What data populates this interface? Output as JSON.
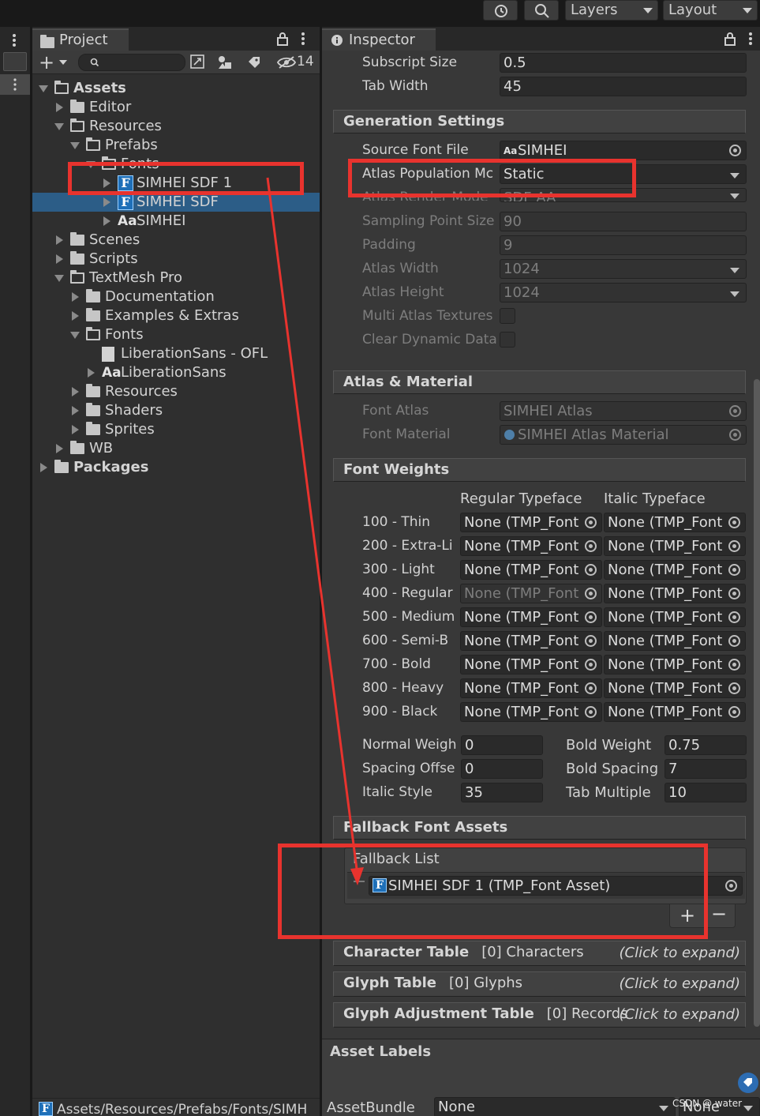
{
  "topbar": {
    "layers_label": "Layers",
    "layout_label": "Layout"
  },
  "project": {
    "tab_label": "Project",
    "hidden_count": "14",
    "tree": [
      {
        "label": "Assets",
        "indent": 0,
        "expanded": true,
        "kind": "folder",
        "bold": true
      },
      {
        "label": "Editor",
        "indent": 1,
        "expanded": false,
        "kind": "folder"
      },
      {
        "label": "Resources",
        "indent": 1,
        "expanded": true,
        "kind": "folder"
      },
      {
        "label": "Prefabs",
        "indent": 2,
        "expanded": true,
        "kind": "folder"
      },
      {
        "label": "Fonts",
        "indent": 3,
        "expanded": true,
        "kind": "folder"
      },
      {
        "label": "SIMHEI SDF 1",
        "indent": 4,
        "expanded": false,
        "kind": "fontasset"
      },
      {
        "label": "SIMHEI SDF",
        "indent": 4,
        "expanded": false,
        "kind": "fontasset",
        "selected": true
      },
      {
        "label": "SIMHEI",
        "indent": 4,
        "expanded": false,
        "kind": "font"
      },
      {
        "label": "Scenes",
        "indent": 1,
        "expanded": false,
        "kind": "folder"
      },
      {
        "label": "Scripts",
        "indent": 1,
        "expanded": false,
        "kind": "folder"
      },
      {
        "label": "TextMesh Pro",
        "indent": 1,
        "expanded": true,
        "kind": "folder"
      },
      {
        "label": "Documentation",
        "indent": 2,
        "expanded": false,
        "kind": "folder"
      },
      {
        "label": "Examples & Extras",
        "indent": 2,
        "expanded": false,
        "kind": "folder"
      },
      {
        "label": "Fonts",
        "indent": 2,
        "expanded": true,
        "kind": "folder"
      },
      {
        "label": "LiberationSans - OFL",
        "indent": 3,
        "expanded": null,
        "kind": "doc"
      },
      {
        "label": "LiberationSans",
        "indent": 3,
        "expanded": false,
        "kind": "font"
      },
      {
        "label": "Resources",
        "indent": 2,
        "expanded": false,
        "kind": "folder"
      },
      {
        "label": "Shaders",
        "indent": 2,
        "expanded": false,
        "kind": "folder"
      },
      {
        "label": "Sprites",
        "indent": 2,
        "expanded": false,
        "kind": "folder"
      },
      {
        "label": "WB",
        "indent": 1,
        "expanded": false,
        "kind": "folder"
      },
      {
        "label": "Packages",
        "indent": 0,
        "expanded": false,
        "kind": "folder",
        "bold": true
      }
    ],
    "footer_path": "Assets/Resources/Prefabs/Fonts/SIMH"
  },
  "inspector": {
    "tab_label": "Inspector",
    "top_fields": [
      {
        "label": "Subscript Size",
        "value": "0.5"
      },
      {
        "label": "Tab Width",
        "value": "45"
      }
    ],
    "generation": {
      "header": "Generation Settings",
      "source_font_label": "Source Font File",
      "source_font_value": "SIMHEI",
      "atlas_population_label": "Atlas Population Mc",
      "atlas_population_value": "Static",
      "render_mode_label": "Atlas Render Mode",
      "render_mode_value": "SDF AA",
      "sampling_label": "Sampling Point Size",
      "sampling_value": "90",
      "padding_label": "Padding",
      "padding_value": "9",
      "atlas_width_label": "Atlas Width",
      "atlas_width_value": "1024",
      "atlas_height_label": "Atlas Height",
      "atlas_height_value": "1024",
      "multi_atlas_label": "Multi Atlas Textures",
      "clear_dynamic_label": "Clear Dynamic Data"
    },
    "atlas_material": {
      "header": "Atlas & Material",
      "font_atlas_label": "Font Atlas",
      "font_atlas_value": "SIMHEI Atlas",
      "font_material_label": "Font Material",
      "font_material_value": "SIMHEI Atlas Material"
    },
    "font_weights": {
      "header": "Font Weights",
      "col_regular": "Regular Typeface",
      "col_italic": "Italic Typeface",
      "none_value": "None (TMP_Font",
      "rows": [
        "100 - Thin",
        "200 - Extra-Li",
        "300 - Light",
        "400 - Regular",
        "500 - Medium",
        "600 - Semi-B",
        "700 - Bold",
        "800 - Heavy",
        "900 - Black"
      ],
      "normal_weight_label": "Normal Weigh",
      "normal_weight_value": "0",
      "bold_weight_label": "Bold Weight",
      "bold_weight_value": "0.75",
      "spacing_offset_label": "Spacing Offse",
      "spacing_offset_value": "0",
      "bold_spacing_label": "Bold Spacing",
      "bold_spacing_value": "7",
      "italic_style_label": "Italic Style",
      "italic_style_value": "35",
      "tab_multiple_label": "Tab Multiple",
      "tab_multiple_value": "10"
    },
    "fallback": {
      "header": "Fallback Font Assets",
      "list_label": "Fallback List",
      "item": "SIMHEI SDF 1 (TMP_Font Asset)"
    },
    "tables": [
      {
        "title": "Character Table",
        "count": "[0] Characters",
        "hint": "(Click to expand)"
      },
      {
        "title": "Glyph Table",
        "count": "[0] Glyphs",
        "hint": "(Click to expand)"
      },
      {
        "title": "Glyph Adjustment Table",
        "count": "[0] Records",
        "hint": "(Click to expand)"
      }
    ],
    "asset_labels": "Asset Labels",
    "assetbundle_label": "AssetBundle",
    "assetbundle_value": "None",
    "assetbundle_variant": "None"
  },
  "watermark": "CSDN @ water",
  "colors": {
    "annotation_red": "#e8332e",
    "selection_blue": "#2c5d87"
  }
}
